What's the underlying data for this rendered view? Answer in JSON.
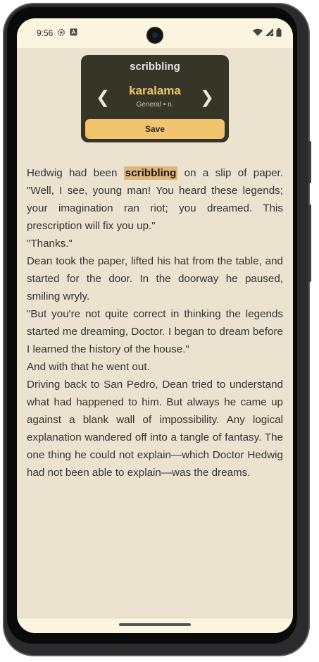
{
  "status_bar": {
    "time": "9:56",
    "icons_left": [
      "settings-icon",
      "text-a-icon"
    ],
    "icons_right": [
      "wifi-icon",
      "signal-icon",
      "battery-icon"
    ]
  },
  "popup": {
    "word": "scribbling",
    "translation": "karalama",
    "meta": "General • n.",
    "prev_arrow": "❮",
    "next_arrow": "❯",
    "save_label": "Save",
    "colors": {
      "bg": "#363628",
      "accent": "#f2c46a",
      "button": "#f2c46d"
    }
  },
  "reader": {
    "highlight_color": "#e0b67c",
    "first_line_before": "Hedwig had been ",
    "highlighted_word": "scribbling",
    "first_line_after": " on a slip of paper. \"Well, I see, young man! You heard these legends; your imagination ran riot; you dreamed. This prescription will fix you up.\"",
    "paragraphs": [
      "\"Thanks.\"",
      "Dean took the paper, lifted his hat from the table, and started for the door. In the doorway he paused, smiling wryly.",
      "\"But you're not quite correct in thinking the legends started me dreaming, Doctor. I began to dream before I learned the history of the house.\"",
      "And with that he went out.",
      "Driving back to San Pedro, Dean tried to understand what had happened to him. But always he came up against a blank wall of impossibility. Any logical explanation wandered off into a tangle of fantasy. The one thing he could not explain—which Doctor Hedwig had not been able to explain—was the dreams."
    ]
  }
}
